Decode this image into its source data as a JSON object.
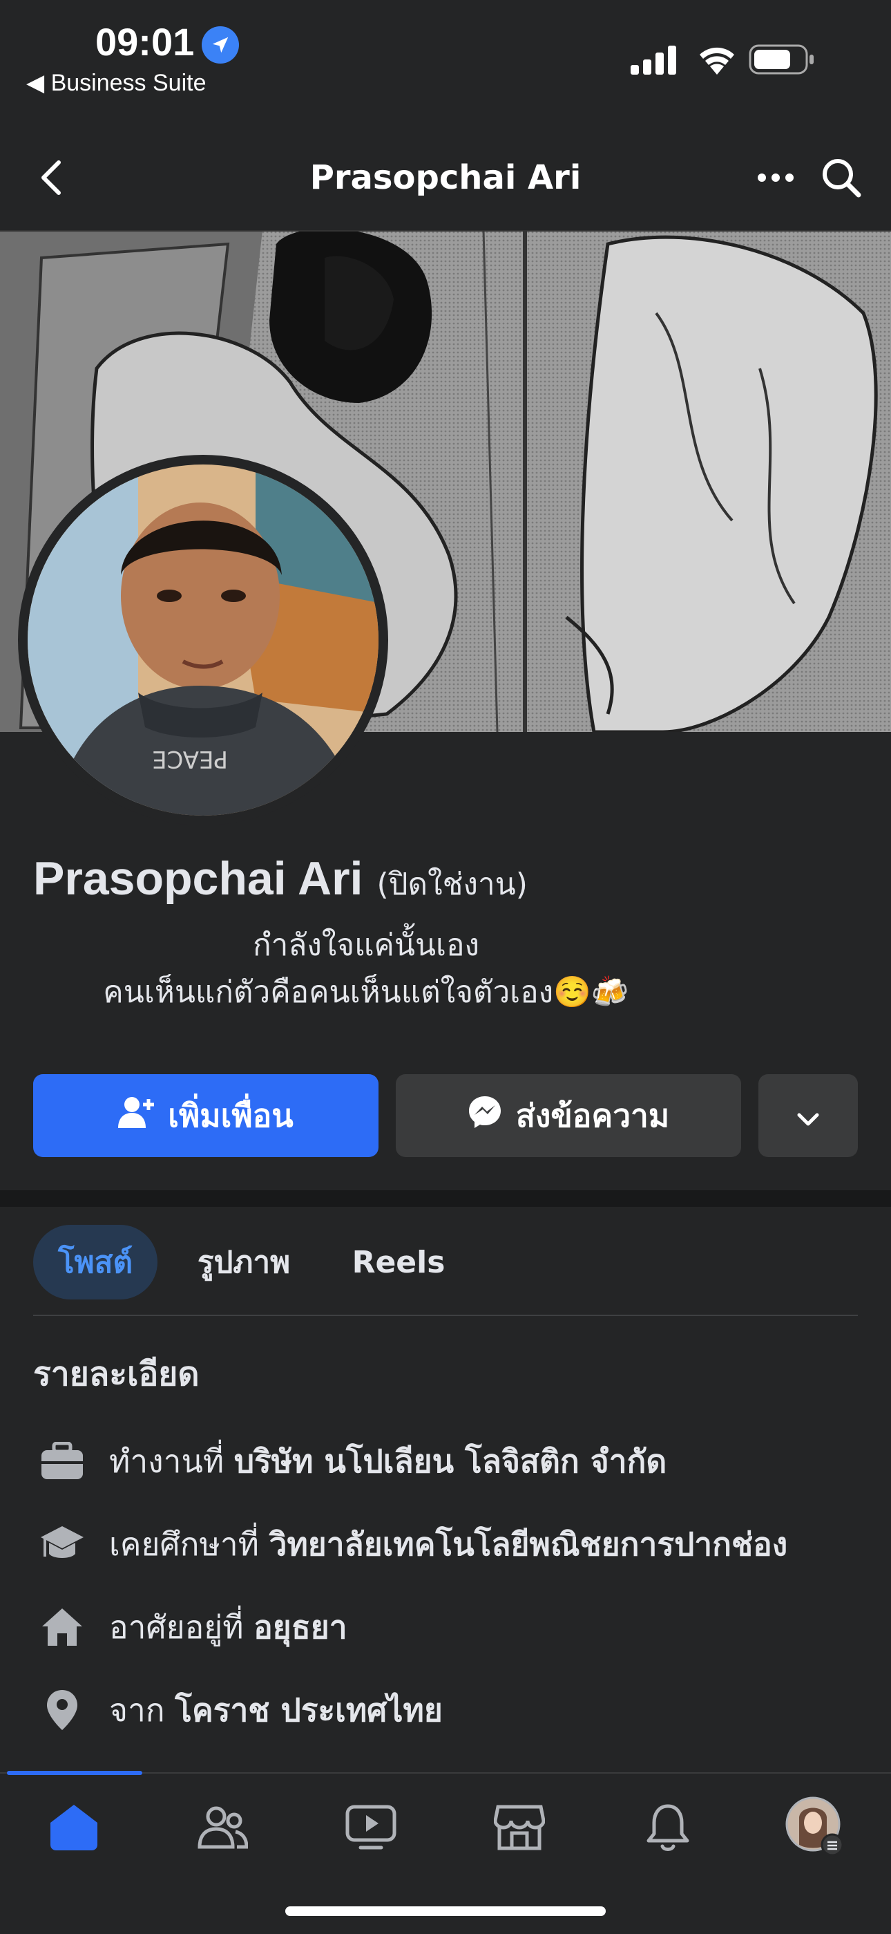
{
  "status_bar": {
    "time": "09:01",
    "back_app": "◀ Business Suite"
  },
  "header": {
    "title": "Prasopchai Ari"
  },
  "profile": {
    "name": "Prasopchai Ari",
    "status": "(ปิดใช่งาน)",
    "bio_line1": "กำลังใจแค่นั้นเอง",
    "bio_line2": "คนเห็นแก่ตัวคือคนเห็นแต่ใจตัวเอง☺️🍻"
  },
  "actions": {
    "add_friend": "เพิ่มเพื่อน",
    "send_message": "ส่งข้อความ"
  },
  "tabs": [
    {
      "label": "โพสต์",
      "active": true
    },
    {
      "label": "รูปภาพ",
      "active": false
    },
    {
      "label": "Reels",
      "active": false
    }
  ],
  "details": {
    "title": "รายละเอียด",
    "items": [
      {
        "icon": "briefcase-icon",
        "prefix": "ทำงานที่",
        "value": "บริษัท นโปเลียน โลจิสติก จำกัด"
      },
      {
        "icon": "graduation-cap-icon",
        "prefix": "เคยศึกษาที่",
        "value": "วิทยาลัยเทคโนโลยีพณิชยการปากช่อง"
      },
      {
        "icon": "home-icon",
        "prefix": "อาศัยอยู่ที่",
        "value": "อยุธยา"
      },
      {
        "icon": "location-pin-icon",
        "prefix": "จาก",
        "value": "โคราช ประเทศไทย"
      }
    ]
  },
  "bottom_nav": [
    "home-icon",
    "friends-icon",
    "video-icon",
    "marketplace-icon",
    "notifications-icon",
    "profile-menu-icon"
  ],
  "colors": {
    "background": "#242526",
    "accent": "#2d6cf6",
    "secondary_button": "#3a3b3c",
    "active_tab_bg": "#263951",
    "active_tab_text": "#4b93f7"
  }
}
